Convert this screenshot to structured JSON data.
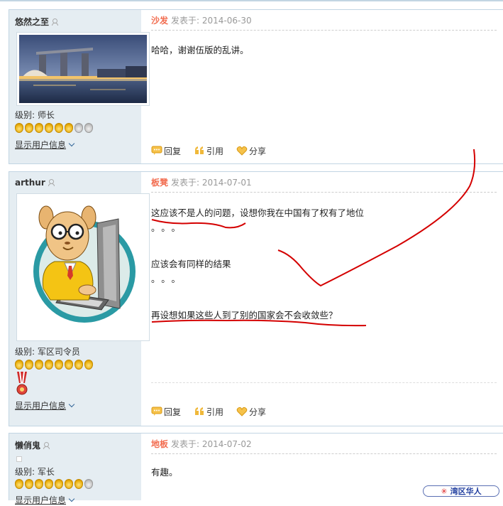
{
  "posts": [
    {
      "username": "悠然之至",
      "floor": "沙发",
      "posted_at": "发表于: 2014-06-30",
      "level": "级别: 师长",
      "medals": [
        "gold",
        "gold",
        "gold",
        "gold",
        "gold",
        "gold",
        "silver",
        "silver"
      ],
      "show_user_info": "显示用户信息",
      "lines": [
        "哈哈，谢谢伍版的乱讲。"
      ]
    },
    {
      "username": "arthur",
      "floor": "板凳",
      "posted_at": "发表于: 2014-07-01",
      "level": "级别: 军区司令员",
      "medals": [
        "gold",
        "gold",
        "gold",
        "gold",
        "gold",
        "gold",
        "gold",
        "gold"
      ],
      "show_user_info": "显示用户信息",
      "lines": [
        "这应该不是人的问题，设想你我在中国有了权有了地位",
        "。。。",
        "应该会有同样的结果",
        "。。。",
        "再设想如果这些人到了别的国家会不会收敛些？"
      ]
    },
    {
      "username": "懒俏鬼",
      "floor": "地板",
      "posted_at": "发表于: 2014-07-02",
      "level": "级别: 军长",
      "medals": [
        "gold",
        "gold",
        "gold",
        "gold",
        "gold",
        "gold",
        "gold",
        "silver"
      ],
      "show_user_info": "显示用户信息",
      "lines": [
        "有趣。"
      ]
    }
  ],
  "actions": {
    "reply": "回复",
    "quote": "引用",
    "share": "分享"
  },
  "watermark": "湾区华人",
  "colors": {
    "floor": "#f26c4f",
    "sidebar": "#e5edf2",
    "border": "#c2d5e3",
    "annotation": "#d40000"
  },
  "icons": {
    "user": "user-icon",
    "reply": "speech-bubble-icon",
    "quote": "quote-marks-icon",
    "share": "heart-icon",
    "medal": "medal-icon"
  }
}
